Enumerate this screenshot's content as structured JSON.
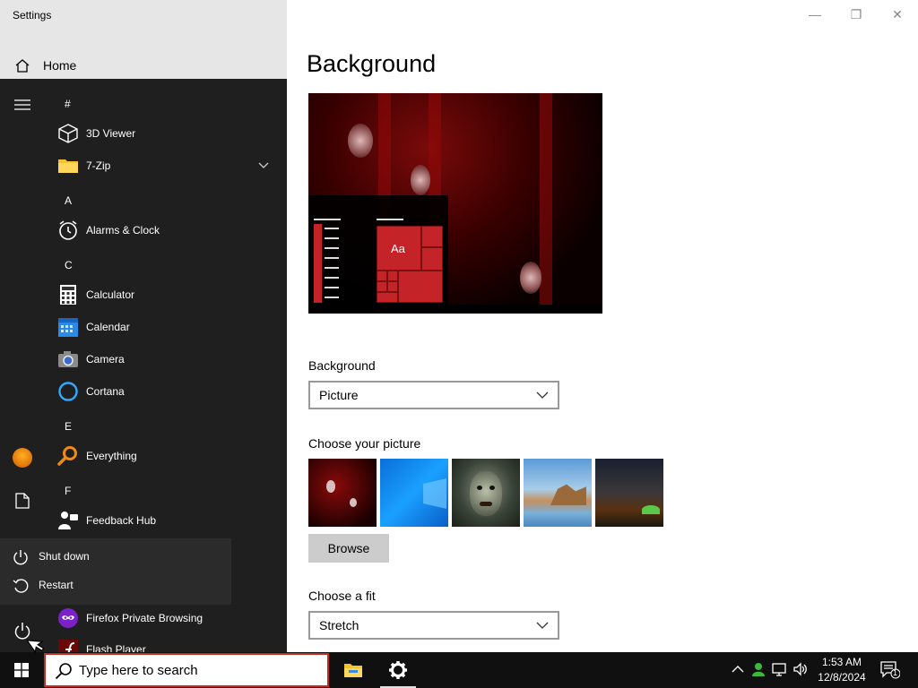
{
  "window": {
    "title": "Settings",
    "controls": {
      "minimize": "—",
      "maximize": "❐",
      "close": "✕"
    }
  },
  "nav": {
    "home_label": "Home"
  },
  "main": {
    "page_title": "Background",
    "preview": {
      "sample_text": "Aa"
    },
    "background_label": "Background",
    "background_value": "Picture",
    "choose_picture_label": "Choose your picture",
    "browse_label": "Browse",
    "choose_fit_label": "Choose a fit",
    "fit_value": "Stretch"
  },
  "start_menu": {
    "groups": [
      {
        "letter": "#",
        "apps": [
          {
            "label": "3D Viewer",
            "icon": "cube-icon"
          },
          {
            "label": "7-Zip",
            "icon": "folder-icon",
            "expandable": true
          }
        ]
      },
      {
        "letter": "A",
        "apps": [
          {
            "label": "Alarms & Clock",
            "icon": "alarm-clock-icon"
          }
        ]
      },
      {
        "letter": "C",
        "apps": [
          {
            "label": "Calculator",
            "icon": "calculator-icon"
          },
          {
            "label": "Calendar",
            "icon": "calendar-icon"
          },
          {
            "label": "Camera",
            "icon": "camera-icon"
          },
          {
            "label": "Cortana",
            "icon": "cortana-icon"
          }
        ]
      },
      {
        "letter": "E",
        "apps": [
          {
            "label": "Everything",
            "icon": "magnifier-icon"
          }
        ]
      },
      {
        "letter": "F",
        "apps": [
          {
            "label": "Feedback Hub",
            "icon": "feedback-icon"
          },
          {
            "label": "Firefox Private Browsing",
            "icon": "firefox-private-icon"
          },
          {
            "label": "Flash Player",
            "icon": "flash-icon"
          }
        ]
      }
    ],
    "power_menu": {
      "shutdown_label": "Shut down",
      "restart_label": "Restart"
    }
  },
  "taskbar": {
    "search_placeholder": "Type here to search",
    "clock_time": "1:53 AM",
    "clock_date": "12/8/2024",
    "notification_count": "1"
  },
  "colors": {
    "accent_red": "#c42428",
    "start_menu_bg": "#1f1f1f",
    "taskbar_bg": "#101010",
    "search_border": "#c42b1c"
  }
}
